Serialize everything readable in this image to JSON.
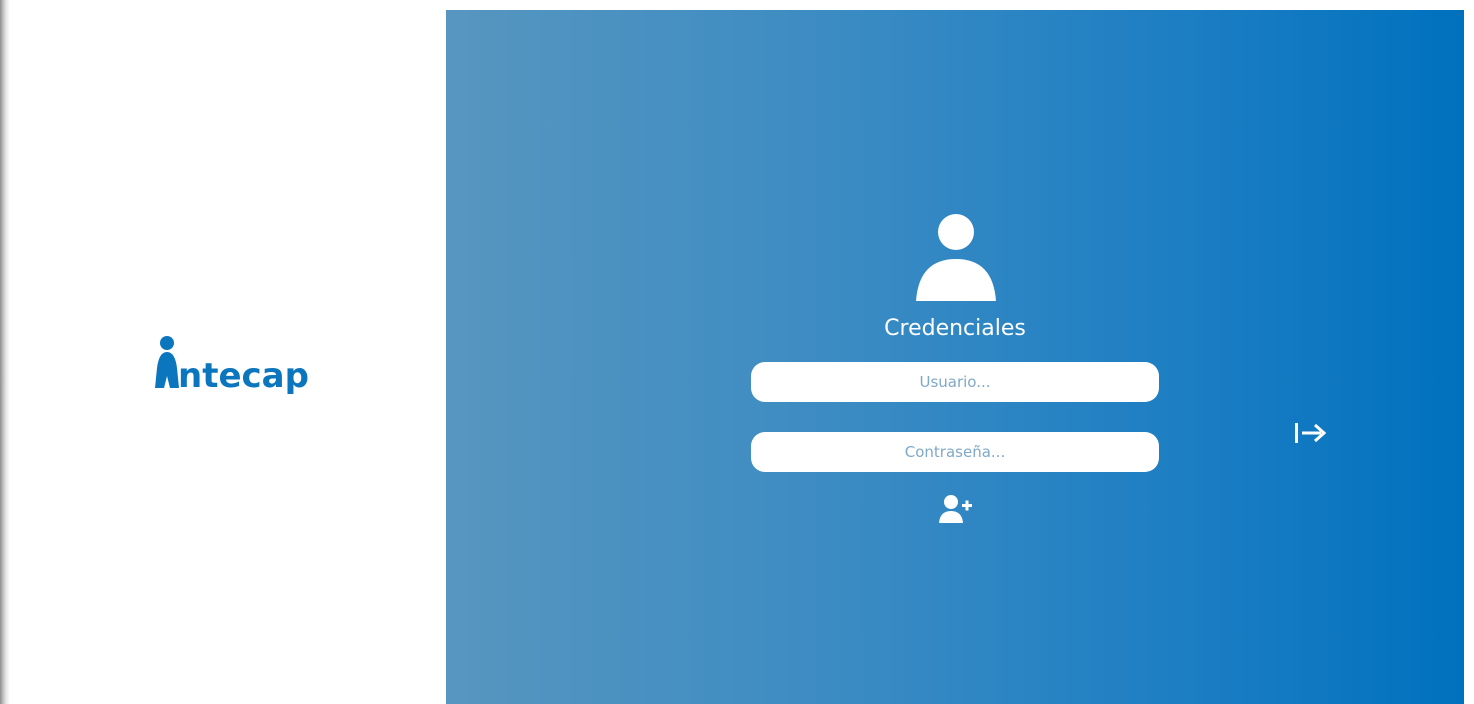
{
  "brand": {
    "logo_text": "ntecap",
    "color": "#0b76be"
  },
  "login": {
    "title": "Credenciales",
    "username": {
      "value": "",
      "placeholder": "Usuario..."
    },
    "password": {
      "value": "",
      "placeholder": "Contraseña..."
    },
    "icons": {
      "avatar": "user-icon",
      "register": "add-user-icon",
      "submit": "sign-in-arrow-icon"
    }
  },
  "colors": {
    "gradient_start": "#5796c0",
    "gradient_end": "#0071be",
    "foreground": "#ffffff"
  }
}
